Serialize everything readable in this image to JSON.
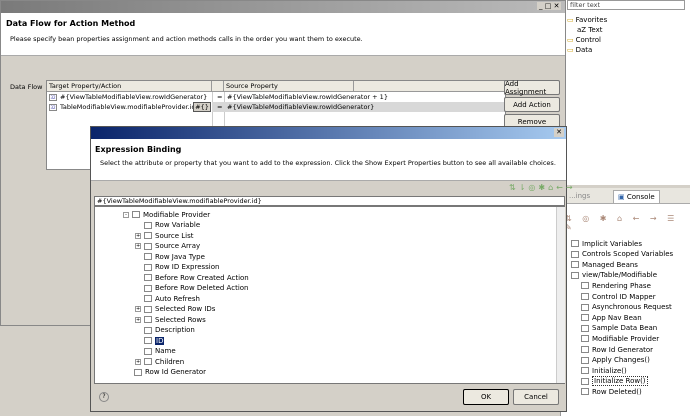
{
  "right_panel": {
    "filter_placeholder": "filter text",
    "palette": [
      {
        "label": "Favorites",
        "icon": "folder-icon"
      },
      {
        "label": "aZ Text",
        "icon": "text-icon"
      },
      {
        "label": "Control",
        "icon": "folder-icon"
      },
      {
        "label": "Data",
        "icon": "folder-icon"
      }
    ],
    "tabs": [
      {
        "label": "...ings"
      },
      {
        "label": "Console"
      }
    ],
    "tree": [
      {
        "label": "Implicit Variables",
        "lvl": 0
      },
      {
        "label": "Controls Scoped Variables",
        "lvl": 0
      },
      {
        "label": "Managed Beans",
        "lvl": 0
      },
      {
        "label": "view/Table/Modifiable",
        "lvl": 0
      },
      {
        "label": "Rendering Phase",
        "lvl": 1
      },
      {
        "label": "Control ID Mapper",
        "lvl": 1
      },
      {
        "label": "Asynchronous Request",
        "lvl": 1
      },
      {
        "label": "App Nav Bean",
        "lvl": 1
      },
      {
        "label": "Sample Data Bean",
        "lvl": 1
      },
      {
        "label": "Modifiable Provider",
        "lvl": 1
      },
      {
        "label": "Row Id Generator",
        "lvl": 1
      },
      {
        "label": "Apply Changes()",
        "lvl": 1
      },
      {
        "label": "Initialize()",
        "lvl": 1
      },
      {
        "label": "Initialize Row()",
        "lvl": 1,
        "selected": true
      },
      {
        "label": "Row Deleted()",
        "lvl": 1
      }
    ]
  },
  "dataflow": {
    "title": "Data Flow for Action Method",
    "description": "Please specify bean properties assignment and action methods calls in the order you want them to execute.",
    "label": "Data Flow",
    "columns": [
      "Target Property/Action",
      "Source Property"
    ],
    "rows": [
      {
        "target": "#{ViewTableModifiableView.rowIdGenerator}",
        "op": "=",
        "source": "#{ViewTableModifiableView.rowIdGenerator + 1}"
      },
      {
        "target": "TableModifiableView.modifiableProvider.id}",
        "op": "=",
        "source": "#{ViewTableModifiableView.rowIdGenerator}",
        "expr_button": "#{}"
      }
    ],
    "buttons": {
      "add_assignment": "Add Assignment",
      "add_action": "Add Action",
      "remove": "Remove"
    }
  },
  "expr": {
    "title": "Expression Binding",
    "description": "Select the attribute or property that you want to add to the expression. Click the Show Expert Properties button to see all available choices.",
    "value": "#{ViewTableModifiableView.modifiableProvider.id}",
    "tree": [
      {
        "label": "Modifiable Provider",
        "lvl": 0,
        "exp": "-",
        "icon": "table-icon"
      },
      {
        "label": "Row Variable",
        "lvl": 1,
        "icon": "string-icon"
      },
      {
        "label": "Source List",
        "lvl": 1,
        "exp": "+",
        "icon": "list-icon"
      },
      {
        "label": "Source Array",
        "lvl": 1,
        "exp": "+",
        "icon": "list-icon"
      },
      {
        "label": "Row Java Type",
        "lvl": 1,
        "icon": "star-icon"
      },
      {
        "label": "Row ID Expression",
        "lvl": 1,
        "icon": "star-icon"
      },
      {
        "label": "Before Row Created Action",
        "lvl": 1,
        "icon": "star-icon"
      },
      {
        "label": "Before Row Deleted Action",
        "lvl": 1,
        "icon": "star-icon"
      },
      {
        "label": "Auto Refresh",
        "lvl": 1,
        "icon": "boolean-icon"
      },
      {
        "label": "Selected Row IDs",
        "lvl": 1,
        "exp": "+",
        "icon": "bean-icon"
      },
      {
        "label": "Selected Rows",
        "lvl": 1,
        "exp": "+",
        "icon": "list-icon"
      },
      {
        "label": "Description",
        "lvl": 1,
        "icon": "string-icon"
      },
      {
        "label": "ID",
        "lvl": 1,
        "icon": "number-icon",
        "selected": true
      },
      {
        "label": "Name",
        "lvl": 1,
        "icon": "string-icon"
      },
      {
        "label": "Children",
        "lvl": 1,
        "exp": "+",
        "icon": "bean-icon"
      },
      {
        "label": "Row Id Generator",
        "lvl": -1,
        "icon": "number-icon"
      }
    ],
    "ok": "OK",
    "cancel": "Cancel"
  }
}
